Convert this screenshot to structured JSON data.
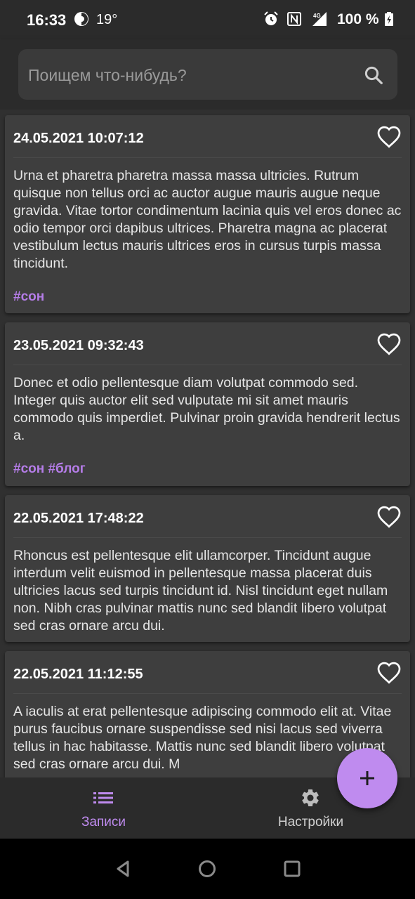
{
  "status_bar": {
    "time": "16:33",
    "temperature": "19°",
    "battery": "100 %",
    "icons": [
      "weather-icon",
      "alarm-icon",
      "nfc-icon",
      "signal-4g-icon",
      "battery-charging-icon"
    ]
  },
  "search": {
    "placeholder": "Поищем что-нибудь?",
    "icon": "search-icon"
  },
  "entries": [
    {
      "date": "24.05.2021 10:07:12",
      "text": "Urna et pharetra pharetra massa massa ultricies. Rutrum quisque non tellus orci ac auctor augue mauris augue neque gravida. Vitae tortor condimentum lacinia quis vel eros donec ac odio tempor orci dapibus ultrices. Pharetra magna ac placerat vestibulum lectus mauris ultrices eros in cursus turpis massa tincidunt.",
      "tags": "#сон",
      "favorite": false
    },
    {
      "date": "23.05.2021 09:32:43",
      "text": "Donec et odio pellentesque diam volutpat commodo sed. Integer quis auctor elit sed vulputate mi sit amet mauris commodo quis imperdiet. Pulvinar proin gravida hendrerit lectus a.",
      "tags": "#сон #блог",
      "favorite": false
    },
    {
      "date": "22.05.2021 17:48:22",
      "text": "Rhoncus est pellentesque elit ullamcorper. Tincidunt augue interdum velit euismod in pellentesque massa placerat duis ultricies lacus sed turpis tincidunt id. Nisl tincidunt eget nullam non. Nibh cras pulvinar mattis nunc sed blandit libero volutpat sed cras ornare arcu dui.",
      "tags": "",
      "favorite": false
    },
    {
      "date": "22.05.2021 11:12:55",
      "text": "A iaculis at erat pellentesque adipiscing commodo elit at. Vitae purus faucibus ornare suspendisse sed nisi lacus sed viverra tellus in hac habitasse. Mattis nunc sed blandit libero volutpat sed cras ornare arcu dui. M",
      "tags": "",
      "favorite": false
    }
  ],
  "bottom_nav": {
    "items": [
      {
        "label": "Записи",
        "icon": "list-icon",
        "active": true
      },
      {
        "label": "Настройки",
        "icon": "gear-icon",
        "active": false
      }
    ]
  },
  "fab": {
    "icon": "plus-icon"
  },
  "colors": {
    "accent": "#bf8bef",
    "tag": "#b57de8",
    "card": "#3e3e3e",
    "background": "#303030",
    "bar": "#2b2b2b"
  }
}
